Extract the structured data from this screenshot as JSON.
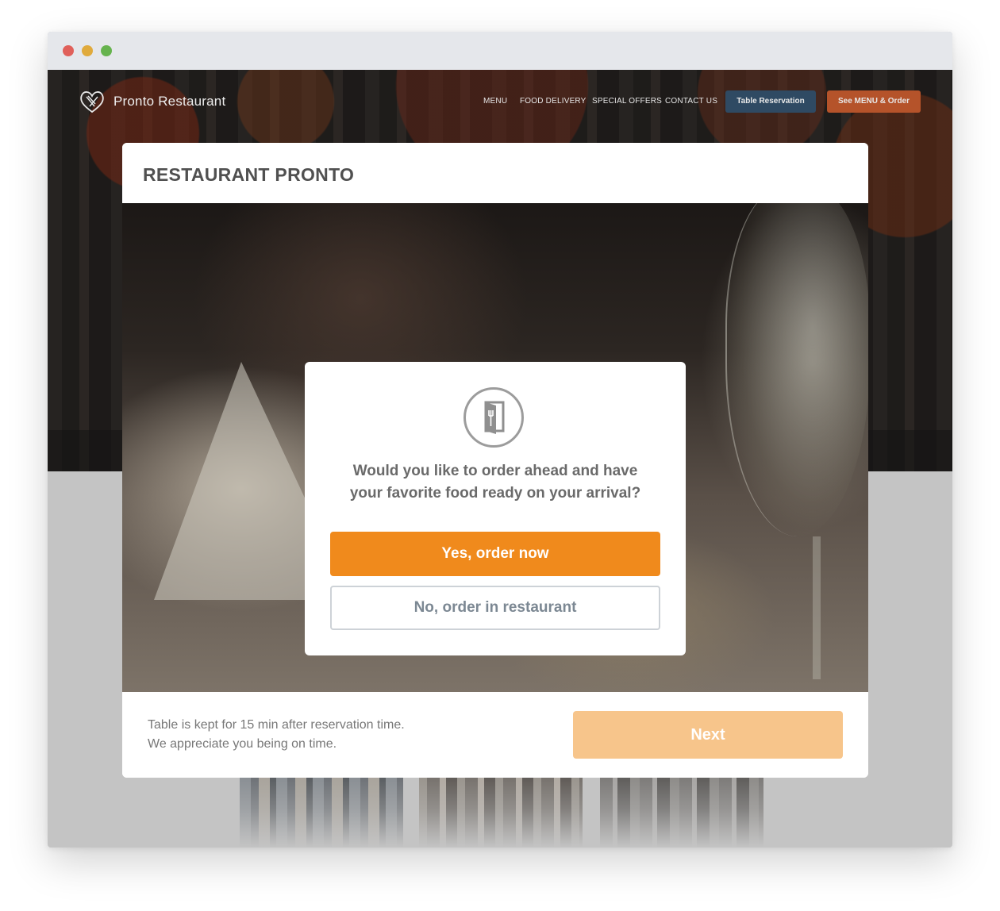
{
  "site": {
    "logo_text": "Pronto Restaurant",
    "nav": [
      "MENU",
      "FOOD DELIVERY",
      "SPECIAL OFFERS",
      "CONTACT US"
    ],
    "table_reservation_label": "Table Reservation",
    "menu_order_label": "See MENU & Order",
    "colors": {
      "reservation_button": "#2f4a63",
      "order_button": "#b5532a"
    }
  },
  "modal": {
    "title": "RESTAURANT PRONTO",
    "dialog": {
      "icon": "restaurant-door-icon",
      "question_line1": "Would you like to order ahead and have",
      "question_line2": "your favorite food ready on your arrival?",
      "yes_label": "Yes, order now",
      "no_label": "No, order in restaurant",
      "colors": {
        "primary": "#f08a1c"
      }
    },
    "footer": {
      "note_line1": "Table is kept for 15 min after reservation time.",
      "note_line2": "We appreciate you being on time.",
      "next_label": "Next",
      "next_color": "#f7c58b"
    }
  }
}
